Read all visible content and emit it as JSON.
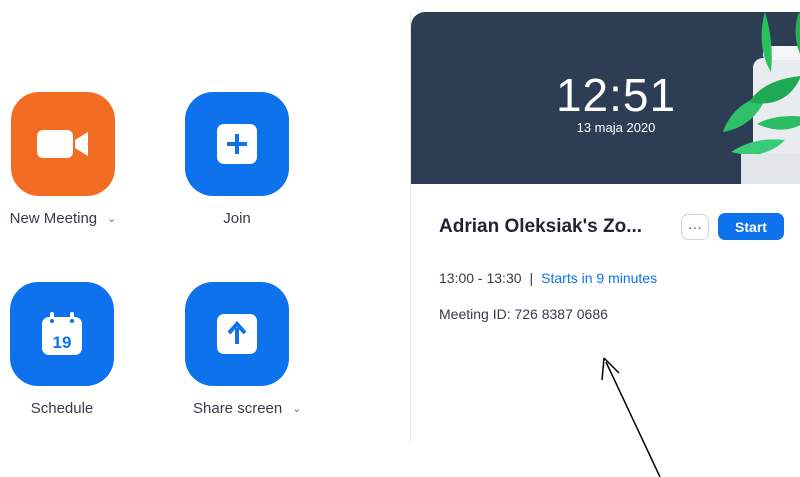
{
  "actions": {
    "new_meeting": {
      "label": "New Meeting",
      "icon": "video-camera-icon",
      "color": "#f26d21"
    },
    "join": {
      "label": "Join",
      "icon": "plus-icon",
      "color": "#0e72ed"
    },
    "schedule": {
      "label": "Schedule",
      "icon": "calendar-icon",
      "day": "19",
      "color": "#0e72ed"
    },
    "share_screen": {
      "label": "Share screen",
      "icon": "arrow-up-icon",
      "color": "#0e72ed"
    }
  },
  "dropdown_icon": "chevron-down-icon",
  "banner": {
    "time": "12:51",
    "date": "13 maja 2020",
    "background": "#2d3e54"
  },
  "meeting": {
    "title": "Adrian Oleksiak's Zo...",
    "more_label": "···",
    "start_label": "Start",
    "time_range": "13:00 - 13:30",
    "separator": "|",
    "starts_in": "Starts in 9 minutes",
    "meeting_id": "Meeting ID: 726 8387 0686"
  }
}
